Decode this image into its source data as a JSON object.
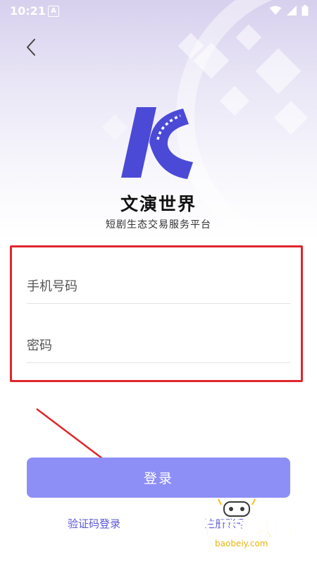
{
  "status_bar": {
    "time": "10:21",
    "notification_letter": "A"
  },
  "app": {
    "name": "文演世界",
    "tagline": "短剧生态交易服务平台"
  },
  "form": {
    "phone_placeholder": "手机号码",
    "password_placeholder": "密码"
  },
  "actions": {
    "login_label": "登录",
    "code_login_label": "验证码登录",
    "register_label": "注册账号"
  },
  "watermark": {
    "text": "宝贝游戏网",
    "url": "baobeiy.com"
  },
  "colors": {
    "accent": "#8e8ef7",
    "logo": "#4b4ad6",
    "link": "#5a58d6",
    "highlight": "#e0262b"
  }
}
